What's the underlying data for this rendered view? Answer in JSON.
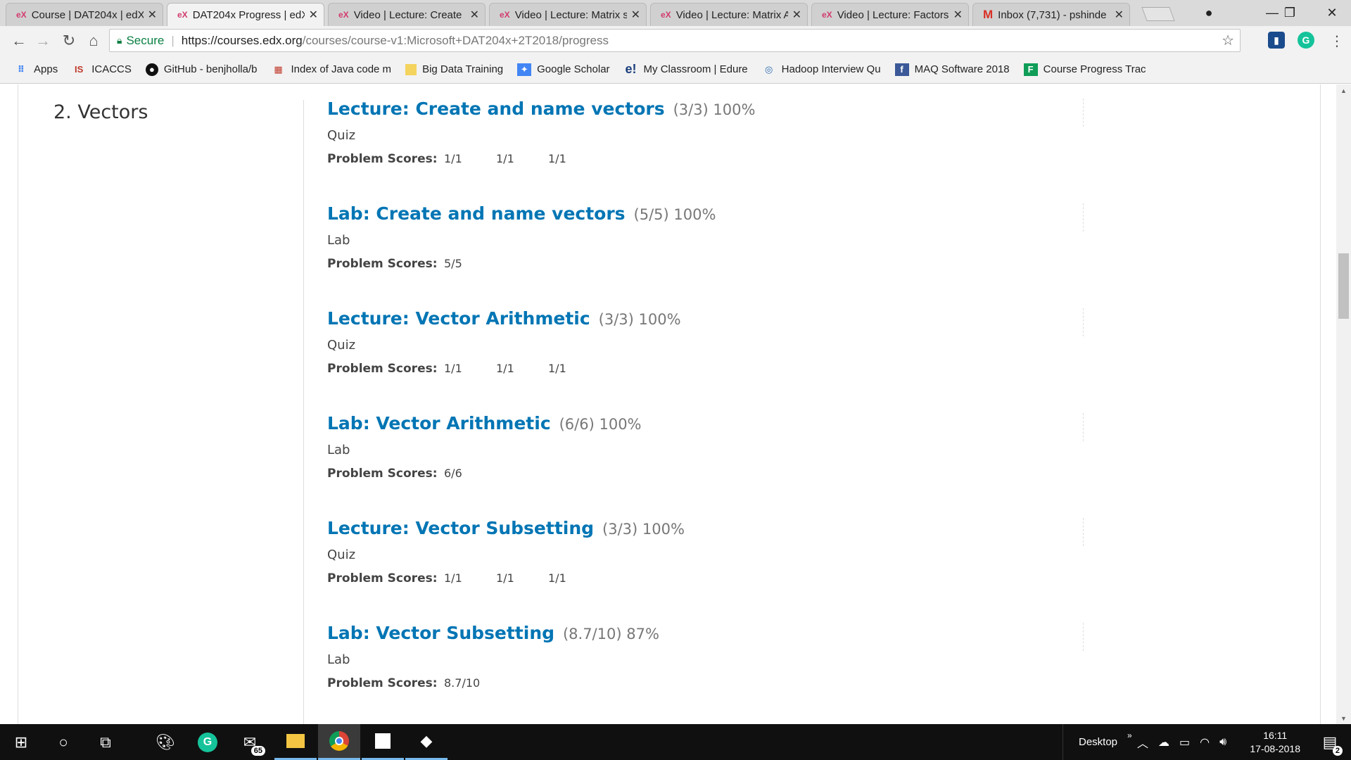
{
  "browser": {
    "tabs": [
      {
        "favicon": "eX",
        "title": "Course | DAT204x | edX",
        "active": false
      },
      {
        "favicon": "eX",
        "title": "DAT204x Progress | edX",
        "active": true
      },
      {
        "favicon": "eX",
        "title": "Video | Lecture: Create",
        "active": false
      },
      {
        "favicon": "eX",
        "title": "Video | Lecture: Matrix s",
        "active": false
      },
      {
        "favicon": "eX",
        "title": "Video | Lecture: Matrix A",
        "active": false
      },
      {
        "favicon": "eX",
        "title": "Video | Lecture: Factors",
        "active": false
      },
      {
        "favicon": "M",
        "title": "Inbox (7,731) - pshinde",
        "active": false
      }
    ],
    "secure_label": "Secure",
    "url_host": "https://courses.edx.org",
    "url_path": "/courses/course-v1:Microsoft+DAT204x+2T2018/progress",
    "bookmarks": [
      {
        "icon": "apps-grid-icon",
        "label": "Apps"
      },
      {
        "icon": "icaccs-icon",
        "label": "ICACCS"
      },
      {
        "icon": "github-icon",
        "label": "GitHub - benjholla/b"
      },
      {
        "icon": "java-site-icon",
        "label": "Index of Java code m"
      },
      {
        "icon": "folder-icon",
        "label": "Big Data Training"
      },
      {
        "icon": "google-scholar-icon",
        "label": "Google Scholar"
      },
      {
        "icon": "edureka-icon",
        "label": "My Classroom | Edure"
      },
      {
        "icon": "hadoop-icon",
        "label": "Hadoop Interview Qu"
      },
      {
        "icon": "facebook-icon",
        "label": "MAQ Software 2018"
      },
      {
        "icon": "sheets-icon",
        "label": "Course Progress Trac"
      }
    ]
  },
  "page": {
    "chapter_title": "2. Vectors",
    "problem_scores_label": "Problem Scores:",
    "sections": [
      {
        "title": "Lecture: Create and name vectors",
        "score": "(3/3) 100%",
        "type": "Quiz",
        "scores": [
          "1/1",
          "1/1",
          "1/1"
        ]
      },
      {
        "title": "Lab: Create and name vectors",
        "score": "(5/5) 100%",
        "type": "Lab",
        "scores": [
          "5/5"
        ]
      },
      {
        "title": "Lecture: Vector Arithmetic",
        "score": "(3/3) 100%",
        "type": "Quiz",
        "scores": [
          "1/1",
          "1/1",
          "1/1"
        ]
      },
      {
        "title": "Lab: Vector Arithmetic",
        "score": "(6/6) 100%",
        "type": "Lab",
        "scores": [
          "6/6"
        ]
      },
      {
        "title": "Lecture: Vector Subsetting",
        "score": "(3/3) 100%",
        "type": "Quiz",
        "scores": [
          "1/1",
          "1/1",
          "1/1"
        ]
      },
      {
        "title": "Lab: Vector Subsetting",
        "score": "(8.7/10) 87%",
        "type": "Lab",
        "scores": [
          "8.7/10"
        ]
      }
    ]
  },
  "taskbar": {
    "mail_badge": "65",
    "desktop_label": "Desktop",
    "time": "16:11",
    "date": "17-08-2018",
    "notification_count": "2"
  },
  "colors": {
    "link_blue": "#0075b4",
    "secure_green": "#0b8043"
  }
}
